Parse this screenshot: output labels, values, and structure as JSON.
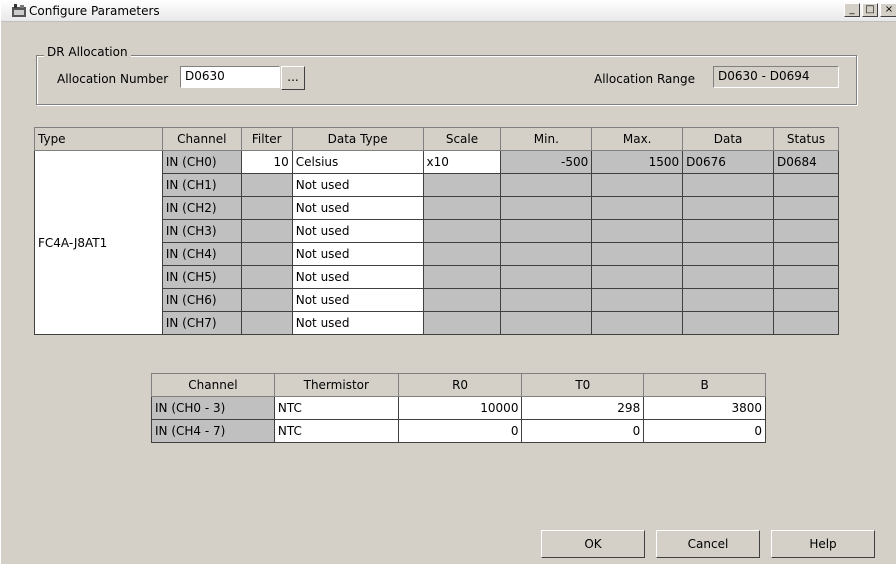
{
  "window": {
    "title": "Configure Parameters",
    "min_label": "_",
    "max_label": "□",
    "close_label": "×"
  },
  "allocation": {
    "group_title": "DR Allocation",
    "number_label": "Allocation Number",
    "number_value": "D0630",
    "browse_label": "...",
    "range_label": "Allocation Range",
    "range_value": "D0630 - D0694"
  },
  "main_table": {
    "headers": [
      "Type",
      "Channel",
      "Filter",
      "Data Type",
      "Scale",
      "Min.",
      "Max.",
      "Data",
      "Status"
    ],
    "type_value": "FC4A-J8AT1",
    "rows": [
      {
        "channel": "IN (CH0)",
        "filter": "10",
        "data_type": "Celsius",
        "scale": "x10",
        "min": "-500",
        "max": "1500",
        "data": "D0676",
        "status": "D0684"
      },
      {
        "channel": "IN (CH1)",
        "filter": "",
        "data_type": "Not used",
        "scale": "",
        "min": "",
        "max": "",
        "data": "",
        "status": ""
      },
      {
        "channel": "IN (CH2)",
        "filter": "",
        "data_type": "Not used",
        "scale": "",
        "min": "",
        "max": "",
        "data": "",
        "status": ""
      },
      {
        "channel": "IN (CH3)",
        "filter": "",
        "data_type": "Not used",
        "scale": "",
        "min": "",
        "max": "",
        "data": "",
        "status": ""
      },
      {
        "channel": "IN (CH4)",
        "filter": "",
        "data_type": "Not used",
        "scale": "",
        "min": "",
        "max": "",
        "data": "",
        "status": ""
      },
      {
        "channel": "IN (CH5)",
        "filter": "",
        "data_type": "Not used",
        "scale": "",
        "min": "",
        "max": "",
        "data": "",
        "status": ""
      },
      {
        "channel": "IN (CH6)",
        "filter": "",
        "data_type": "Not used",
        "scale": "",
        "min": "",
        "max": "",
        "data": "",
        "status": ""
      },
      {
        "channel": "IN (CH7)",
        "filter": "",
        "data_type": "Not used",
        "scale": "",
        "min": "",
        "max": "",
        "data": "",
        "status": ""
      }
    ]
  },
  "thermistor_table": {
    "headers": [
      "Channel",
      "Thermistor",
      "R0",
      "T0",
      "B"
    ],
    "rows": [
      {
        "channel": "IN (CH0 - 3)",
        "thermistor": "NTC",
        "r0": "10000",
        "t0": "298",
        "b": "3800"
      },
      {
        "channel": "IN (CH4 - 7)",
        "thermistor": "NTC",
        "r0": "0",
        "t0": "0",
        "b": "0"
      }
    ]
  },
  "buttons": {
    "ok": "OK",
    "cancel": "Cancel",
    "help": "Help"
  }
}
